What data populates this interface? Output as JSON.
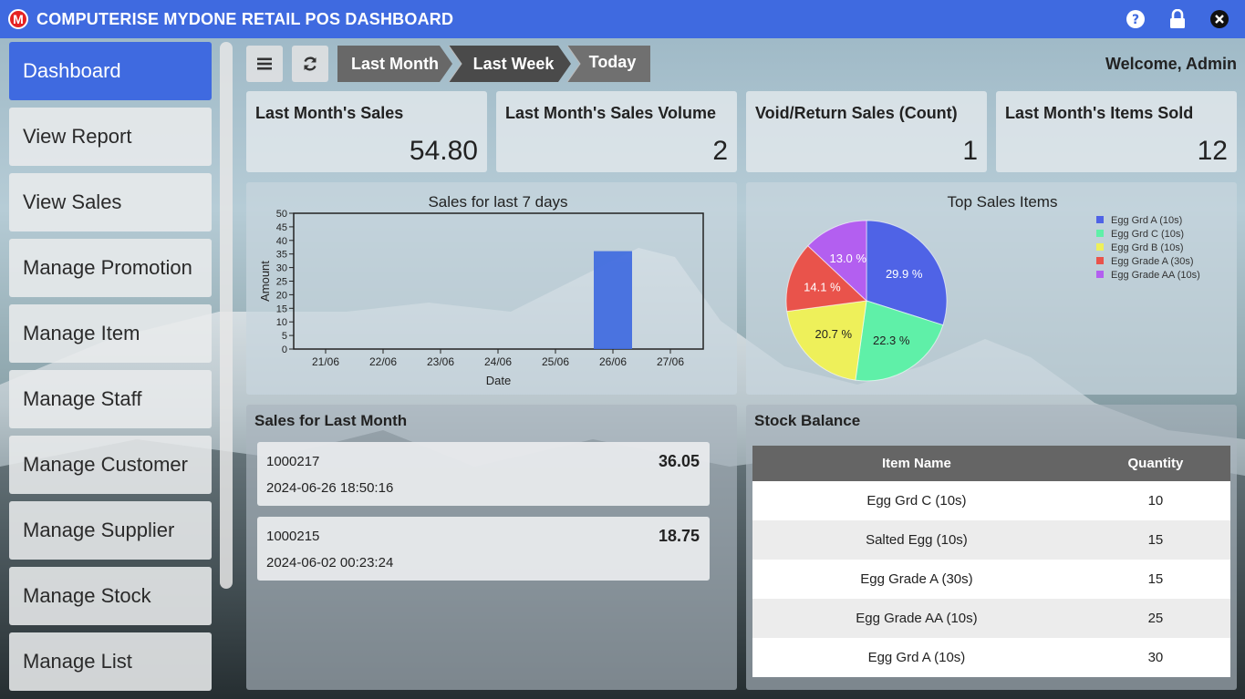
{
  "window": {
    "logo_letter": "M",
    "title": "COMPUTERISE MYDONE RETAIL POS DASHBOARD"
  },
  "title_icons": [
    "help-icon",
    "lock-icon",
    "close-icon"
  ],
  "sidebar": {
    "items": [
      {
        "label": "Dashboard",
        "active": true
      },
      {
        "label": "View Report"
      },
      {
        "label": "View Sales"
      },
      {
        "label": "Manage Promotion"
      },
      {
        "label": "Manage Item"
      },
      {
        "label": "Manage Staff"
      },
      {
        "label": "Manage Customer"
      },
      {
        "label": "Manage Supplier"
      },
      {
        "label": "Manage Stock"
      },
      {
        "label": "Manage List"
      }
    ]
  },
  "toolbar": {
    "menu_icon": "hamburger-icon",
    "refresh_icon": "refresh-icon",
    "periods": [
      "Last Month",
      "Last Week",
      "Today"
    ],
    "welcome": "Welcome, Admin"
  },
  "stats": [
    {
      "title": "Last Month's Sales",
      "value": "54.80"
    },
    {
      "title": "Last Month's Sales Volume",
      "value": "2"
    },
    {
      "title": "Void/Return Sales (Count)",
      "value": "1"
    },
    {
      "title": "Last Month's Items Sold",
      "value": "12"
    }
  ],
  "chart_data": [
    {
      "type": "bar",
      "title": "Sales for last 7 days",
      "xlabel": "Date",
      "ylabel": "Amount",
      "categories": [
        "21/06",
        "22/06",
        "23/06",
        "24/06",
        "25/06",
        "26/06",
        "27/06"
      ],
      "values": [
        0,
        0,
        0,
        0,
        0,
        36.05,
        0
      ],
      "ylim": [
        0,
        50
      ],
      "yticks": [
        0,
        5,
        10,
        15,
        20,
        25,
        30,
        35,
        40,
        45,
        50
      ],
      "ytick_labels": [
        "0",
        "5",
        "10",
        "15",
        "20",
        "25",
        "30",
        "35",
        "40",
        "45",
        "50"
      ],
      "color": "#3f6ae0"
    },
    {
      "type": "pie",
      "title": "Top Sales Items",
      "legend_position": "top-right",
      "labels": [
        "Egg Grd A (10s)",
        "Egg Grd C (10s)",
        "Egg Grd B (10s)",
        "Egg Grade A (30s)",
        "Egg Grade AA (10s)"
      ],
      "values": [
        29.9,
        22.3,
        20.7,
        14.1,
        13.0
      ],
      "value_labels": [
        "29.9 %",
        "22.3 %",
        "20.7 %",
        "14.1 %",
        "13.0 %"
      ],
      "colors": [
        "#4f63e6",
        "#5ff0a8",
        "#eef05a",
        "#e9534b",
        "#b35ff0"
      ]
    }
  ],
  "sales_last_month": {
    "heading": "Sales for Last Month",
    "items": [
      {
        "id": "1000217",
        "date": "2024-06-26 18:50:16",
        "amount": "36.05"
      },
      {
        "id": "1000215",
        "date": "2024-06-02 00:23:24",
        "amount": "18.75"
      }
    ]
  },
  "stock_balance": {
    "heading": "Stock Balance",
    "columns": [
      "Item Name",
      "Quantity"
    ],
    "rows": [
      [
        "Egg Grd C (10s)",
        "10"
      ],
      [
        "Salted Egg (10s)",
        "15"
      ],
      [
        "Egg Grade A (30s)",
        "15"
      ],
      [
        "Egg Grade AA (10s)",
        "25"
      ],
      [
        "Egg Grd A (10s)",
        "30"
      ]
    ]
  }
}
